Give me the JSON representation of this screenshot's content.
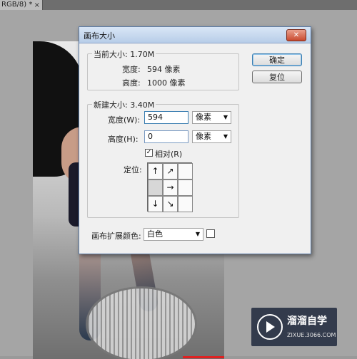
{
  "doc_tab": {
    "label": "RGB/8) *",
    "close_glyph": "×"
  },
  "dialog": {
    "title": "画布大小",
    "close_glyph": "✕",
    "buttons": {
      "ok": "确定",
      "reset": "复位"
    },
    "current_size": {
      "title": "当前大小: 1.70M",
      "width_label": "宽度:",
      "width_value": "594 像素",
      "height_label": "高度:",
      "height_value": "1000 像素"
    },
    "new_size": {
      "title": "新建大小: 3.40M",
      "width_label": "宽度(W):",
      "width_value": "594",
      "width_unit": "像素",
      "height_label": "高度(H):",
      "height_value": "0",
      "height_unit": "像素",
      "relative_label": "相对(R)",
      "relative_checked": "✓",
      "anchor_label": "定位:",
      "anchor_cells": [
        "↑",
        "↗",
        "",
        "",
        "→",
        "",
        "↓",
        "↘",
        ""
      ]
    },
    "extension_color": {
      "label": "画布扩展颜色:",
      "value": "白色"
    }
  },
  "watermark": {
    "title": "溜溜自学",
    "subtitle": "ZIXUE.3066.COM"
  }
}
